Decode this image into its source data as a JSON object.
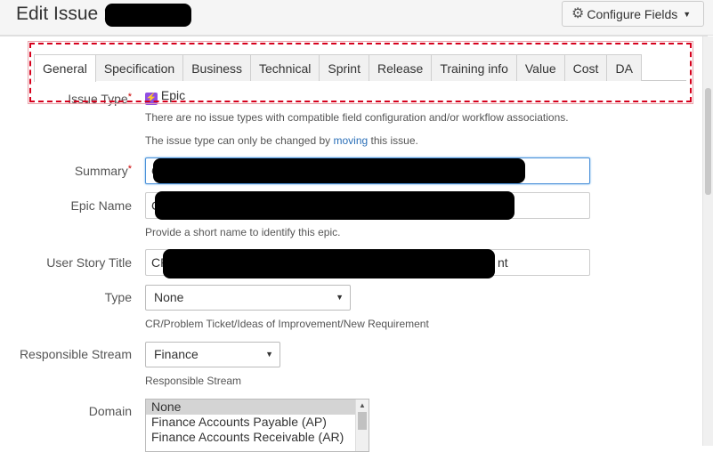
{
  "header": {
    "title": "Edit Issue : CP",
    "configure_label": "Configure Fields",
    "configure_icon": "gear-icon"
  },
  "tabs": [
    {
      "label": "General",
      "active": true
    },
    {
      "label": "Specification"
    },
    {
      "label": "Business"
    },
    {
      "label": "Technical"
    },
    {
      "label": "Sprint"
    },
    {
      "label": "Release"
    },
    {
      "label": "Training info"
    },
    {
      "label": "Value"
    },
    {
      "label": "Cost"
    },
    {
      "label": "DA"
    }
  ],
  "fields": {
    "issue_type": {
      "label": "Issue Type",
      "value": "Epic",
      "hint1": "There are no issue types with compatible field configuration and/or workflow associations.",
      "hint2_pre": "The issue type can only be changed by ",
      "hint2_link": "moving",
      "hint2_post": " this issue."
    },
    "summary": {
      "label": "Summary",
      "value": "C"
    },
    "epic_name": {
      "label": "Epic Name",
      "value": "C",
      "hint": "Provide a short name to identify this epic."
    },
    "user_story_title": {
      "label": "User Story Title",
      "value": "CP",
      "value_tail": "nt"
    },
    "type": {
      "label": "Type",
      "value": "None",
      "hint": "CR/Problem Ticket/Ideas of Improvement/New Requirement"
    },
    "responsible_stream": {
      "label": "Responsible Stream",
      "value": "Finance",
      "hint": "Responsible Stream"
    },
    "domain": {
      "label": "Domain",
      "options": [
        "None",
        "Finance Accounts Payable (AP)",
        "Finance Accounts Receivable (AR)"
      ]
    }
  },
  "required_mark": "*",
  "colors": {
    "selection_border": "#d6001c",
    "epic": "#904ee2",
    "link": "#2a6fb8"
  }
}
